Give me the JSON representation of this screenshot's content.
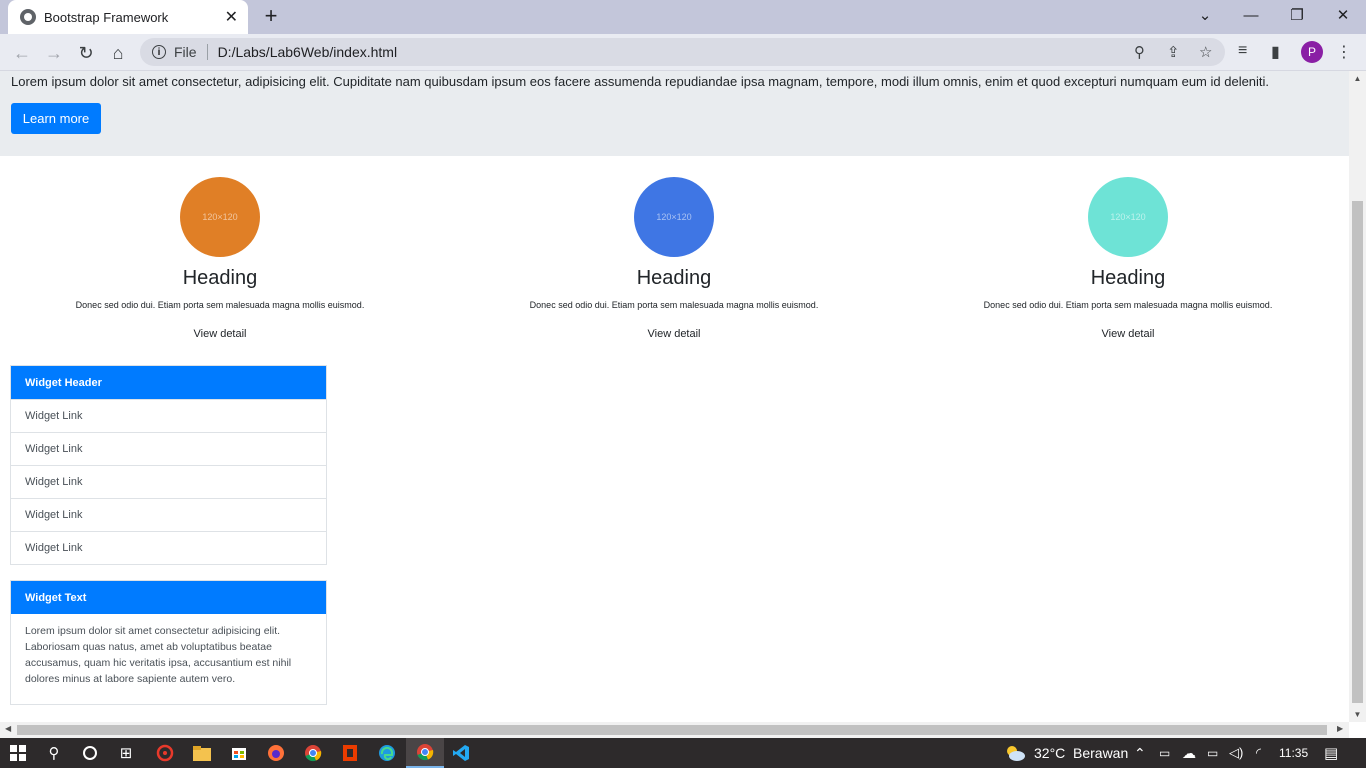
{
  "browser": {
    "tab_title": "Bootstrap Framework",
    "tab_close": "✕",
    "new_tab": "+",
    "url_scheme": "File",
    "url": "D:/Labs/Lab6Web/index.html",
    "profile_initial": "P"
  },
  "jumbotron": {
    "text": "Lorem ipsum dolor sit amet consectetur, adipisicing elit. Cupiditate nam quibusdam ipsum eos facere assumenda repudiandae ipsa magnam, tempore, modi illum omnis, enim et quod excepturi numquam eum id deleniti.",
    "button_label": "Learn more"
  },
  "features": [
    {
      "placeholder": "120×120",
      "color": "#e07f26",
      "heading": "Heading",
      "text": "Donec sed odio dui. Etiam porta sem malesuada magna mollis euismod.",
      "link": "View detail"
    },
    {
      "placeholder": "120×120",
      "color": "#3f76e4",
      "heading": "Heading",
      "text": "Donec sed odio dui. Etiam porta sem malesuada magna mollis euismod.",
      "link": "View detail"
    },
    {
      "placeholder": "120×120",
      "color": "#6ee3d6",
      "heading": "Heading",
      "text": "Donec sed odio dui. Etiam porta sem malesuada magna mollis euismod.",
      "link": "View detail"
    }
  ],
  "widget_links": {
    "header": "Widget Header",
    "items": [
      "Widget Link",
      "Widget Link",
      "Widget Link",
      "Widget Link",
      "Widget Link"
    ]
  },
  "widget_text": {
    "header": "Widget Text",
    "body": "Lorem ipsum dolor sit amet consectetur adipisicing elit. Laboriosam quas natus, amet ab voluptatibus beatae accusamus, quam hic veritatis ipsa, accusantium est nihil dolores minus at labore sapiente autem vero."
  },
  "taskbar": {
    "weather": "32°C",
    "weather_desc": "Berawan",
    "time": "11:35"
  }
}
